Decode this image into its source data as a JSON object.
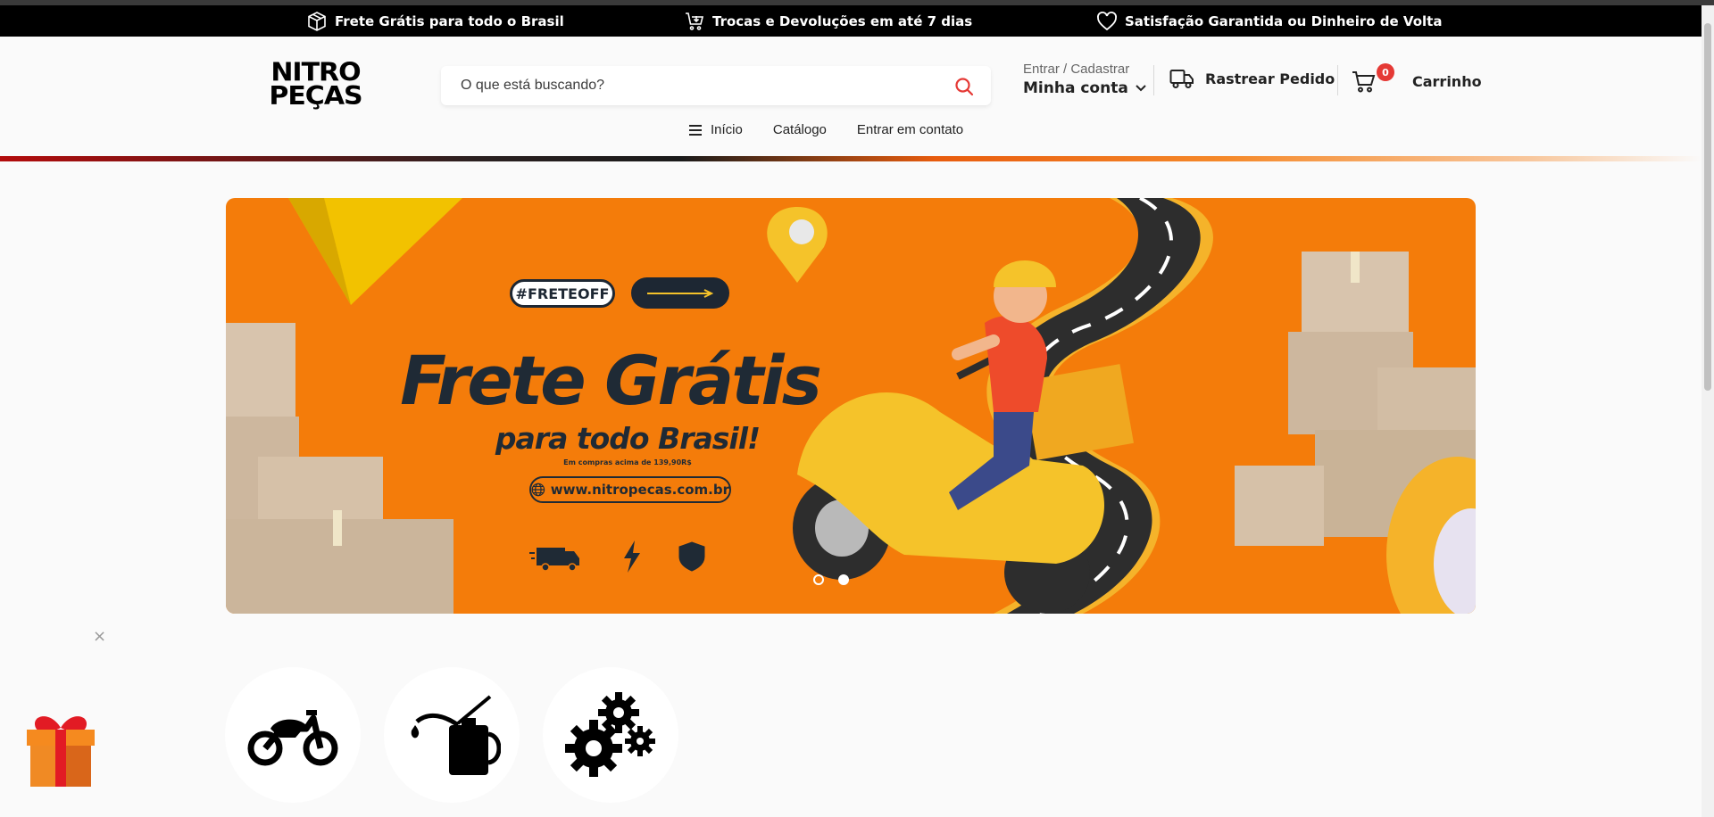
{
  "promo_bar": {
    "items": [
      {
        "icon": "box-icon",
        "text": "Frete Grátis para todo o Brasil"
      },
      {
        "icon": "cart-return-icon",
        "text": "Trocas e Devoluções em até 7 dias"
      },
      {
        "icon": "heart-icon",
        "text": "Satisfação Garantida ou Dinheiro de Volta"
      }
    ]
  },
  "header": {
    "logo_line1": "NITRO",
    "logo_line2": "PEÇAS",
    "search_placeholder": "O que está buscando?",
    "account_sub": "Entrar / Cadastrar",
    "account_main": "Minha conta",
    "track_label": "Rastrear Pedido",
    "cart_count": "0",
    "cart_label": "Carrinho"
  },
  "nav": {
    "items": [
      "Início",
      "Catálogo",
      "Entrar em contato"
    ]
  },
  "banner": {
    "hashtag": "#FRETEOFF",
    "headline": "Frete Grátis",
    "subline": "para todo Brasil!",
    "note": "Em compras acima de 139,90R$",
    "url": "www.nitropecas.com.br",
    "slides_total": 2,
    "active_slide": 2
  },
  "popup": {
    "close": "×"
  },
  "categories": [
    {
      "icon": "motorcycle-icon"
    },
    {
      "icon": "oil-can-icon"
    },
    {
      "icon": "gears-icon"
    }
  ],
  "colors": {
    "promo_bg": "#000000",
    "banner_bg": "#f47c0a",
    "banner_text": "#1f2a35",
    "badge_red": "#e53935",
    "search_icon": "#e53935"
  }
}
